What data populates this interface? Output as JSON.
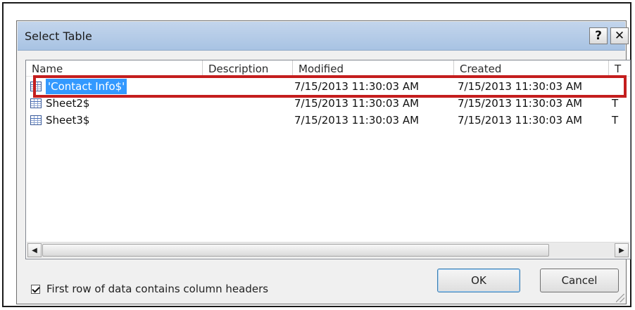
{
  "dialog": {
    "title": "Select Table",
    "help_glyph": "?",
    "close_glyph": "✕"
  },
  "list": {
    "columns": [
      "Name",
      "Description",
      "Modified",
      "Created",
      "T"
    ],
    "rows": [
      {
        "name": "'Contact Info$'",
        "description": "",
        "modified": "7/15/2013 11:30:03 AM",
        "created": "7/15/2013 11:30:03 AM",
        "more": "",
        "selected": true,
        "icon": "table-icon"
      },
      {
        "name": "Sheet2$",
        "description": "",
        "modified": "7/15/2013 11:30:03 AM",
        "created": "7/15/2013 11:30:03 AM",
        "more": "T",
        "selected": false,
        "icon": "table-icon"
      },
      {
        "name": "Sheet3$",
        "description": "",
        "modified": "7/15/2013 11:30:03 AM",
        "created": "7/15/2013 11:30:03 AM",
        "more": "T",
        "selected": false,
        "icon": "table-icon"
      }
    ],
    "scroll_left_glyph": "◀",
    "scroll_right_glyph": "▶"
  },
  "footer": {
    "checkbox_label": "First row of data contains column headers",
    "checkbox_checked": true,
    "ok_label": "OK",
    "cancel_label": "Cancel"
  },
  "colors": {
    "selection": "#3399ff",
    "highlight": "#c41e1e",
    "title_bar": "#b6cce8"
  }
}
